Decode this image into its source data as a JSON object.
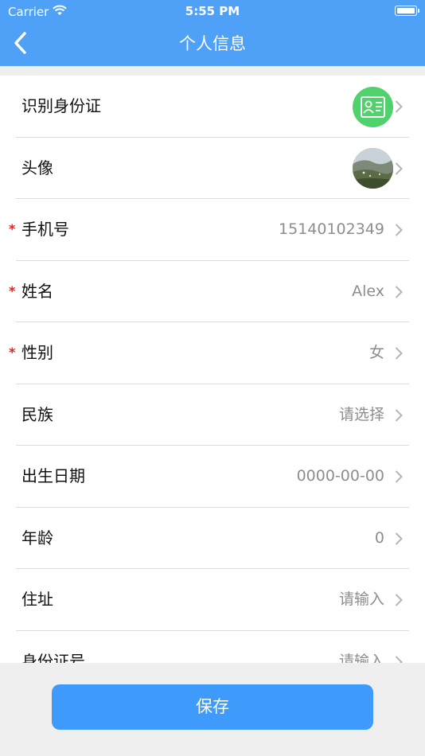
{
  "status_bar": {
    "carrier": "Carrier",
    "time": "5:55 PM"
  },
  "nav": {
    "title": "个人信息"
  },
  "rows": [
    {
      "label": "识别身份证",
      "value": "",
      "required": false,
      "icon": "id-card-icon"
    },
    {
      "label": "头像",
      "value": "",
      "required": false,
      "icon": "avatar-image"
    },
    {
      "label": "手机号",
      "value": "15140102349",
      "required": true
    },
    {
      "label": "姓名",
      "value": "Alex",
      "required": true
    },
    {
      "label": "性别",
      "value": "女",
      "required": true
    },
    {
      "label": "民族",
      "value": "请选择",
      "required": false
    },
    {
      "label": "出生日期",
      "value": "0000-00-00",
      "required": false
    },
    {
      "label": "年龄",
      "value": "0",
      "required": false
    },
    {
      "label": "住址",
      "value": "请输入",
      "required": false
    },
    {
      "label": "身份证号",
      "value": "请输入",
      "required": false
    }
  ],
  "required_mark": "*",
  "save_label": "保存",
  "colors": {
    "header": "#4ea1f7",
    "button": "#3e9bfb",
    "required": "#e02020",
    "id_icon_bg": "#4fd26c"
  }
}
